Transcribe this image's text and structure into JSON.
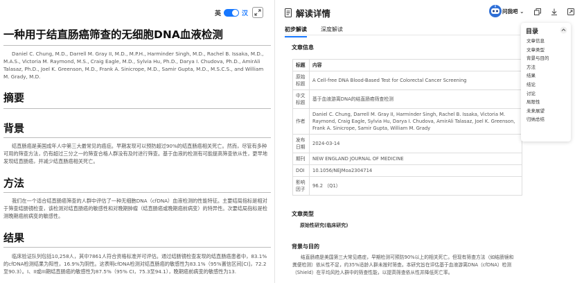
{
  "left": {
    "lang_en": "英",
    "lang_zh": "汉",
    "title": "一种用于结直肠癌筛查的无细胞DNA血液检测",
    "authors": "Daniel C. Chung, M.D., Darrell M. Gray II, M.D., M.P.H., Harminder Singh, M.D., Rachel B. Issaka, M.D., M.A.S., Victoria M. Raymond, M.S., Craig Eagle, M.D., Sylvia Hu, Ph.D., Darya I. Chudova, Ph.D., AmirAli Talasaz, Ph.D., Joel K. Greenson, M.D., Frank A. Sinicrope, M.D., Samir Gupta, M.D., M.S.C.S., and William M. Grady, M.D.",
    "abstract_heading": "摘要",
    "background_heading": "背景",
    "background_text": "结直肠癌是美国成年人中第三大最常见的癌症。早期发现可以预防超过90%的结直肠癌相关死亡。然而，尽管有多种可用的筛查方法，仍有超过三分之一的筛查合格人群没有及时进行筛查。基于血液的检测有可能提高筛查依从性，更早地发现结直肠癌，并减少结直肠癌相关死亡。",
    "methods_heading": "方法",
    "methods_text": "我们在一个适合结直肠癌筛查的人群中评估了一种无细胞DNA（cfDNA）血液检测的性能特征。主要结局指标是相对于筛查结肠镜检查，该检测对结直肠癌的敏感性和对晚期肿瘤（结直肠癌或晚期癌前病变）的特异性。次要结局指标是检测晚期癌前病变的敏感性。",
    "results_heading": "结果",
    "results_text": "临床验证队列包括10,258人，其中7861人符合资格标准并可评估。通过结肠镜检查发现的结直肠癌患者中，83.1%的cfDNA检测结果为阳性，16.9%为阴性。这表明cfDNA检测对结直肠癌的敏感性为83.1%（95%置信区间[CI]，72.2至90.3）。I、II或III期结直肠癌的敏感性为87.5%（95% CI，75.3至94.1），晚期癌前病变的敏感性为13."
  },
  "right": {
    "title": "解读详情",
    "ask_label": "问我吧",
    "tabs": [
      "初步解读",
      "深度解读"
    ],
    "article_info_heading": "文章信息",
    "table_header": {
      "k": "标题",
      "v": "内容"
    },
    "table_rows": [
      {
        "k": "原始标题",
        "v": "A Cell-free DNA Blood-Based Test for Colorectal Cancer Screening"
      },
      {
        "k": "中文标题",
        "v": "基于血液游离DNA的结直肠癌筛查检测"
      },
      {
        "k": "作者",
        "v": "Daniel C. Chung, Darrell M. Gray II, Harminder Singh, Rachel B. Issaka, Victoria M. Raymond, Craig Eagle, Sylvia Hu, Darya I. Chudova, AmirAli Talasaz, Joel K. Greenson, Frank A. Sinicrope, Samir Gupta, William M. Grady"
      },
      {
        "k": "发布日期",
        "v": "2024-03-14"
      },
      {
        "k": "期刊",
        "v": "NEW ENGLAND JOURNAL OF MEDICINE"
      },
      {
        "k": "DOI",
        "v": "10.1056/NEJMoa2304714"
      },
      {
        "k": "影响因子",
        "v": "96.2 （Q1）"
      }
    ],
    "article_type_heading": "文章类型",
    "article_type_value": "原始性研究(临床研究)",
    "background_heading": "背景与目的",
    "background_text": "结直肠癌是美国第三大常见癌症，早期检测可预防90%以上的相关死亡。但现有筛查方法（如结肠镜和粪便检测）依从性不足，约35%适龄人群未按时筛查。本研究旨在评估基于血液游离DNA（cfDNA）检测（Shield）在平均风险人群中的筛查性能，以提高筛查依从性并降低死亡率。"
  },
  "toc": {
    "heading": "目录",
    "items": [
      "文章信息",
      "文章类型",
      "背景与目的",
      "方法",
      "结果",
      "结论",
      "讨论",
      "局限性",
      "未来展望",
      "归纳总结"
    ]
  },
  "colors": {
    "accent": "#1677ff"
  }
}
